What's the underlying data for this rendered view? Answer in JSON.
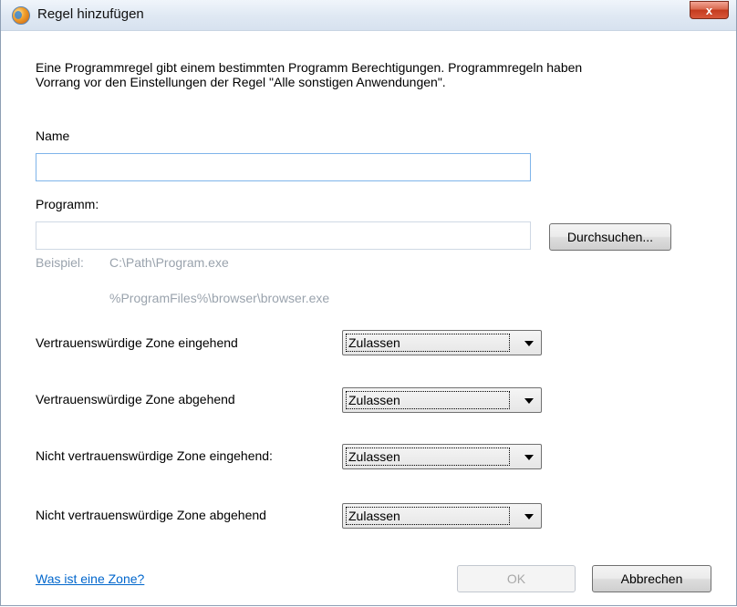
{
  "window": {
    "title": "Regel hinzufügen",
    "close_label": "x"
  },
  "intro": {
    "line1": "Eine Programmregel gibt einem bestimmten Programm Berechtigungen. Programmregeln haben",
    "line2": "Vorrang vor den Einstellungen der Regel \"Alle sonstigen Anwendungen\"."
  },
  "name_field": {
    "label": "Name",
    "value": ""
  },
  "program_field": {
    "label": "Programm:",
    "value": "",
    "browse_label": "Durchsuchen..."
  },
  "example": {
    "label": "Beispiel:",
    "path1": "C:\\Path\\Program.exe",
    "path2": "%ProgramFiles%\\browser\\browser.exe"
  },
  "zones": [
    {
      "label": "Vertrauenswürdige Zone eingehend",
      "value": "Zulassen"
    },
    {
      "label": "Vertrauenswürdige Zone abgehend",
      "value": "Zulassen"
    },
    {
      "label": "Nicht vertrauenswürdige Zone eingehend:",
      "value": "Zulassen"
    },
    {
      "label": "Nicht vertrauenswürdige Zone abgehend",
      "value": "Zulassen"
    }
  ],
  "footer": {
    "help_link": "Was ist eine Zone?",
    "ok_label": "OK",
    "cancel_label": "Abbrechen"
  }
}
